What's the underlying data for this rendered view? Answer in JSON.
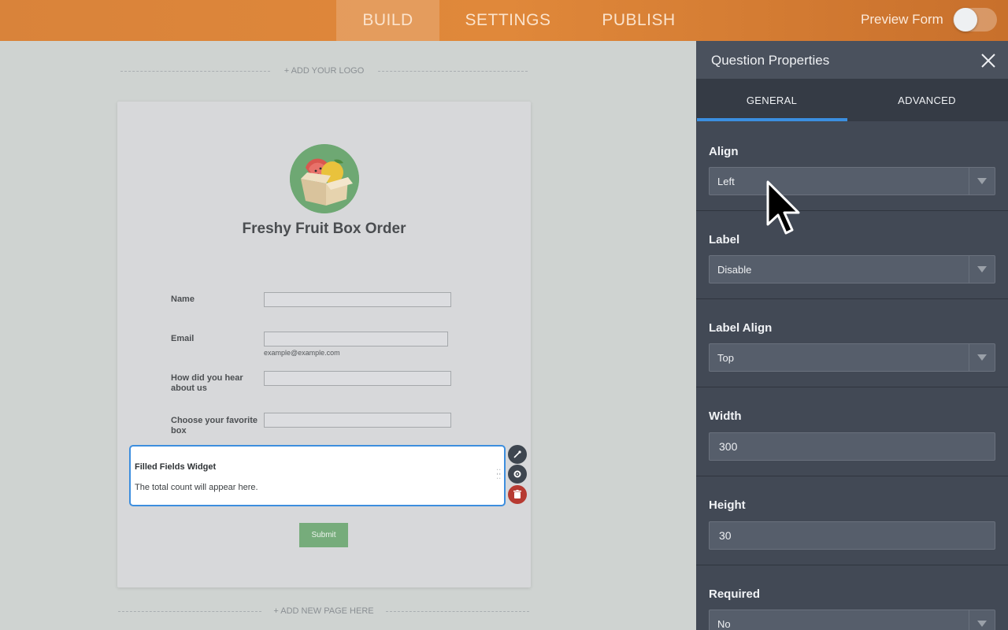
{
  "topbar": {
    "nav": [
      "BUILD",
      "SETTINGS",
      "PUBLISH"
    ],
    "active_nav": "BUILD",
    "preview_label": "Preview Form",
    "preview_on": false
  },
  "canvas": {
    "add_logo": "+ ADD YOUR LOGO",
    "add_page": "+ ADD NEW PAGE HERE"
  },
  "form": {
    "title": "Freshy Fruit Box Order",
    "logo_icon": "fruit-box-icon",
    "fields": [
      {
        "label": "Name"
      },
      {
        "label": "Email",
        "sublabel": "example@example.com"
      },
      {
        "label": "How did you hear about us"
      },
      {
        "label": "Choose your favorite box"
      }
    ],
    "widget": {
      "title": "Filled Fields Widget",
      "text": "The total count will appear here."
    },
    "submit_label": "Submit",
    "submit_color": "#76ac7b"
  },
  "panel": {
    "title": "Question Properties",
    "tabs": [
      "GENERAL",
      "ADVANCED"
    ],
    "active_tab": "GENERAL",
    "accent": "#3b8fe0",
    "properties": [
      {
        "label": "Align",
        "type": "select",
        "value": "Left"
      },
      {
        "label": "Label",
        "type": "select",
        "value": "Disable"
      },
      {
        "label": "Label Align",
        "type": "select",
        "value": "Top"
      },
      {
        "label": "Width",
        "type": "text",
        "value": "300"
      },
      {
        "label": "Height",
        "type": "text",
        "value": "30"
      },
      {
        "label": "Required",
        "type": "select",
        "value": "No"
      }
    ]
  }
}
